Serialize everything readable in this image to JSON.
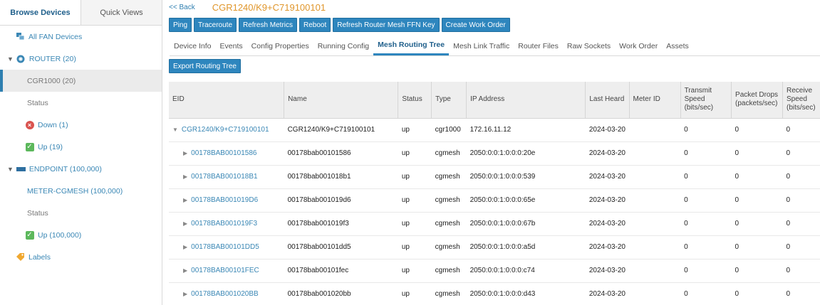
{
  "sidebar": {
    "tabs": [
      {
        "label": "Browse Devices",
        "active": true
      },
      {
        "label": "Quick Views",
        "active": false
      }
    ],
    "items": {
      "all_fan": "All FAN Devices",
      "router": "ROUTER (20)",
      "cgr1000": "CGR1000 (20)",
      "router_status": "Status",
      "down": "Down (1)",
      "up": "Up (19)",
      "endpoint": "ENDPOINT (100,000)",
      "meter": "METER-CGMESH (100,000)",
      "endpoint_status": "Status",
      "endpoint_up": "Up (100,000)",
      "labels": "Labels"
    }
  },
  "header": {
    "back": "<< Back",
    "title": "CGR1240/K9+C719100101"
  },
  "actions": [
    "Ping",
    "Traceroute",
    "Refresh Metrics",
    "Reboot",
    "Refresh Router Mesh FFN Key",
    "Create Work Order"
  ],
  "tabs": [
    {
      "label": "Device Info",
      "active": false
    },
    {
      "label": "Events",
      "active": false
    },
    {
      "label": "Config Properties",
      "active": false
    },
    {
      "label": "Running Config",
      "active": false
    },
    {
      "label": "Mesh Routing Tree",
      "active": true
    },
    {
      "label": "Mesh Link Traffic",
      "active": false
    },
    {
      "label": "Router Files",
      "active": false
    },
    {
      "label": "Raw Sockets",
      "active": false
    },
    {
      "label": "Work Order",
      "active": false
    },
    {
      "label": "Assets",
      "active": false
    }
  ],
  "export_label": "Export Routing Tree",
  "table": {
    "headers": {
      "eid": "EID",
      "name": "Name",
      "status": "Status",
      "type": "Type",
      "ip": "IP Address",
      "last_heard": "Last Heard",
      "meter_id": "Meter ID",
      "tx": "Transmit Speed (bits/sec)",
      "drops": "Packet Drops (packets/sec)",
      "rx": "Receive Speed (bits/sec)"
    },
    "rows": [
      {
        "eid": "CGR1240/K9+C719100101",
        "name": "CGR1240/K9+C719100101",
        "status": "up",
        "type": "cgr1000",
        "ip": "172.16.11.12",
        "last_heard": "2024-03-20",
        "meter_id": "",
        "tx": "0",
        "drops": "0",
        "rx": "0"
      },
      {
        "eid": "00178BAB00101586",
        "name": "00178bab00101586",
        "status": "up",
        "type": "cgmesh",
        "ip": "2050:0:0:1:0:0:0:20e",
        "last_heard": "2024-03-20",
        "meter_id": "",
        "tx": "0",
        "drops": "0",
        "rx": "0"
      },
      {
        "eid": "00178BAB001018B1",
        "name": "00178bab001018b1",
        "status": "up",
        "type": "cgmesh",
        "ip": "2050:0:0:1:0:0:0:539",
        "last_heard": "2024-03-20",
        "meter_id": "",
        "tx": "0",
        "drops": "0",
        "rx": "0"
      },
      {
        "eid": "00178BAB001019D6",
        "name": "00178bab001019d6",
        "status": "up",
        "type": "cgmesh",
        "ip": "2050:0:0:1:0:0:0:65e",
        "last_heard": "2024-03-20",
        "meter_id": "",
        "tx": "0",
        "drops": "0",
        "rx": "0"
      },
      {
        "eid": "00178BAB001019F3",
        "name": "00178bab001019f3",
        "status": "up",
        "type": "cgmesh",
        "ip": "2050:0:0:1:0:0:0:67b",
        "last_heard": "2024-03-20",
        "meter_id": "",
        "tx": "0",
        "drops": "0",
        "rx": "0"
      },
      {
        "eid": "00178BAB00101DD5",
        "name": "00178bab00101dd5",
        "status": "up",
        "type": "cgmesh",
        "ip": "2050:0:0:1:0:0:0:a5d",
        "last_heard": "2024-03-20",
        "meter_id": "",
        "tx": "0",
        "drops": "0",
        "rx": "0"
      },
      {
        "eid": "00178BAB00101FEC",
        "name": "00178bab00101fec",
        "status": "up",
        "type": "cgmesh",
        "ip": "2050:0:0:1:0:0:0:c74",
        "last_heard": "2024-03-20",
        "meter_id": "",
        "tx": "0",
        "drops": "0",
        "rx": "0"
      },
      {
        "eid": "00178BAB001020BB",
        "name": "00178bab001020bb",
        "status": "up",
        "type": "cgmesh",
        "ip": "2050:0:0:1:0:0:0:d43",
        "last_heard": "2024-03-20",
        "meter_id": "",
        "tx": "0",
        "drops": "0",
        "rx": "0"
      }
    ]
  },
  "colors": {
    "accent": "#2e86be",
    "title": "#e0962b",
    "up": "#5cb85c",
    "down": "#d9534f"
  }
}
